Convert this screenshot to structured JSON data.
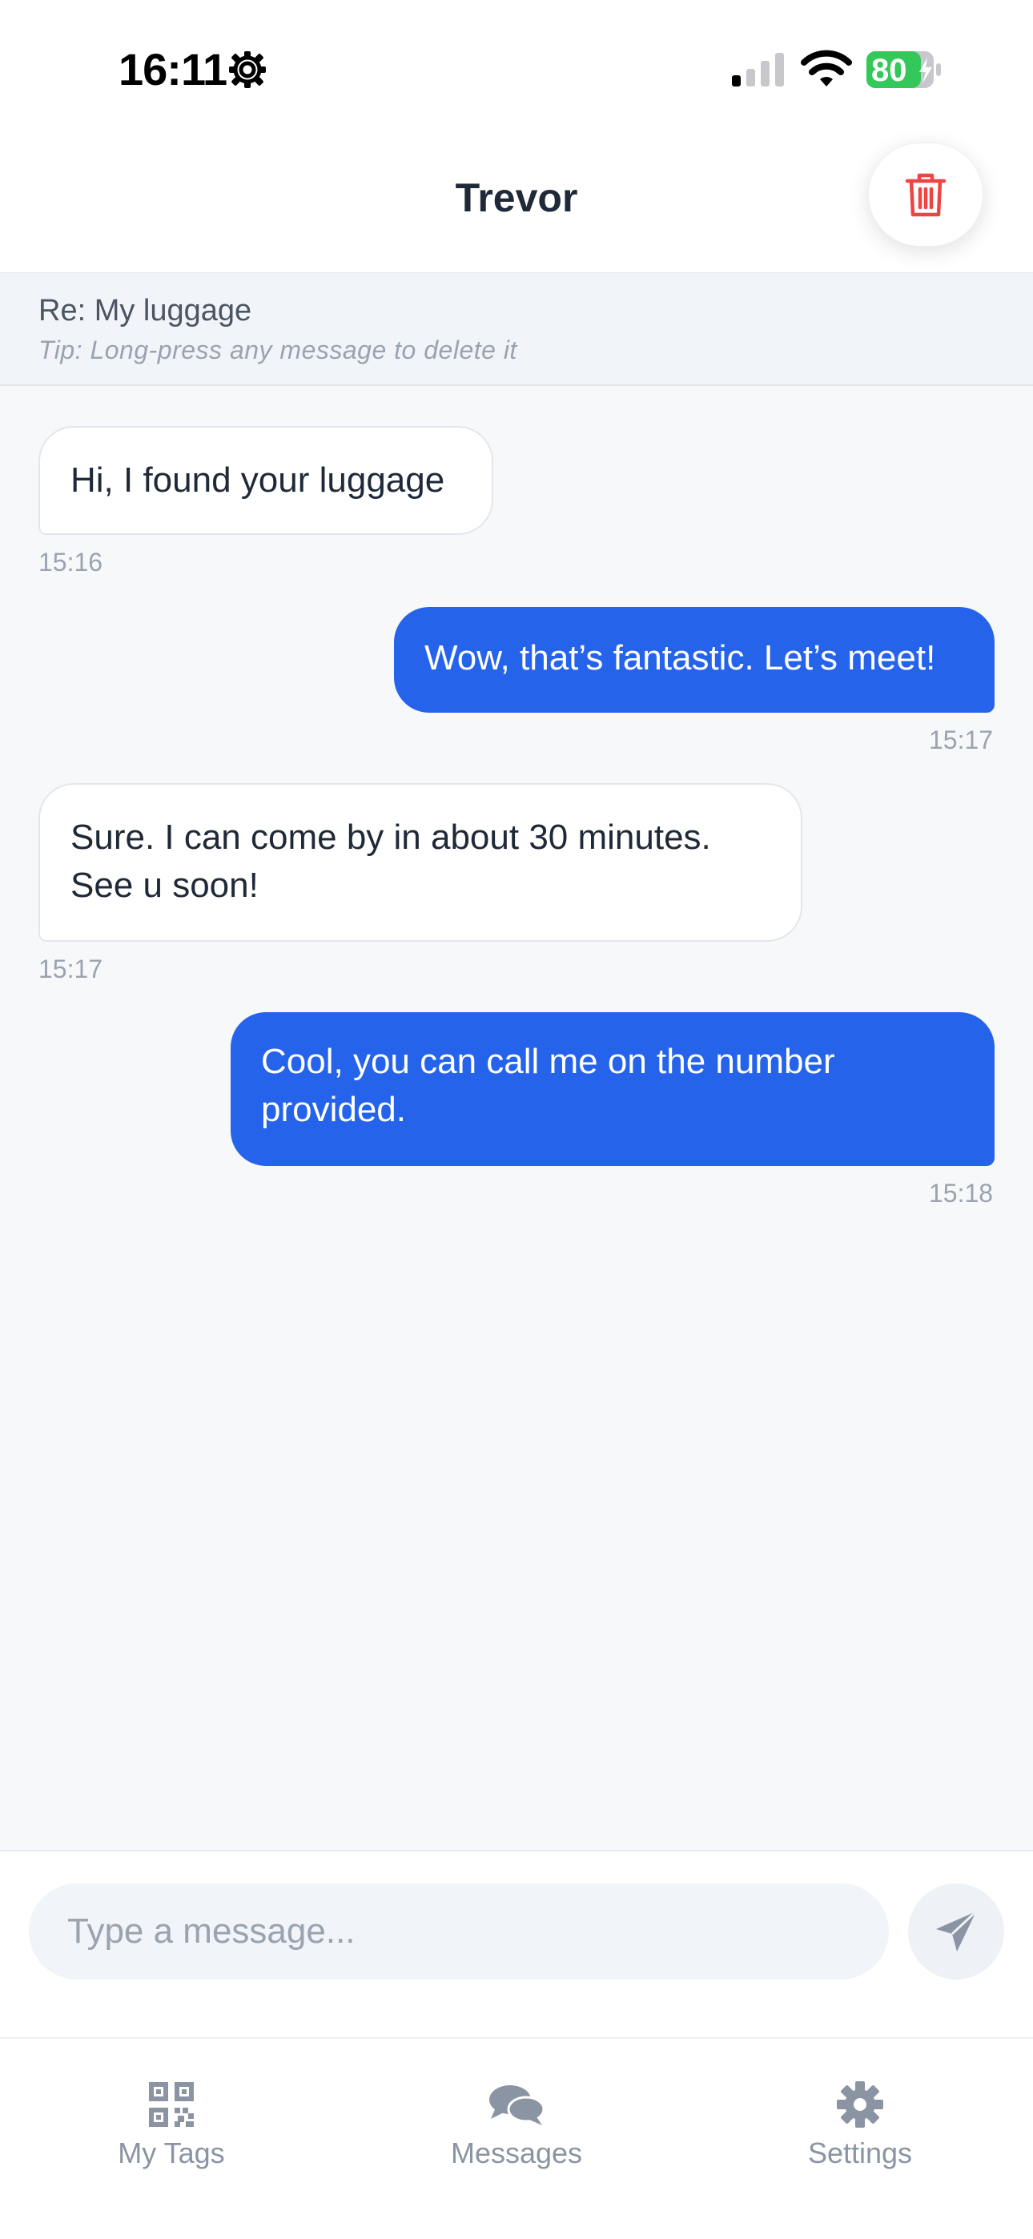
{
  "status_bar": {
    "time": "16:11",
    "battery": "80"
  },
  "header": {
    "title": "Trevor",
    "delete_icon": "trash-icon"
  },
  "subject": {
    "title": "Re: My luggage",
    "tip": "Tip: Long-press any message to delete it"
  },
  "messages": [
    {
      "direction": "incoming",
      "lines": [
        "Hi, I found your luggage"
      ],
      "time": "15:16"
    },
    {
      "direction": "outgoing",
      "lines": [
        "Wow, that’s fantastic. Let’s meet!"
      ],
      "time": "15:17"
    },
    {
      "direction": "incoming",
      "lines": [
        "Sure. I can come by in about 30 minutes.",
        "See u soon!"
      ],
      "time": "15:17"
    },
    {
      "direction": "outgoing",
      "lines": [
        "Cool, you can call me on the number",
        "provided."
      ],
      "time": "15:18"
    }
  ],
  "composer": {
    "placeholder": "Type a message...",
    "send_icon": "send-icon"
  },
  "tabs": [
    {
      "label": "My Tags",
      "icon": "qr-code-icon"
    },
    {
      "label": "Messages",
      "icon": "chat-bubbles-icon"
    },
    {
      "label": "Settings",
      "icon": "gear-icon"
    }
  ],
  "colors": {
    "accent": "#2563eb",
    "delete": "#ef4444",
    "battery": "#34c759"
  }
}
